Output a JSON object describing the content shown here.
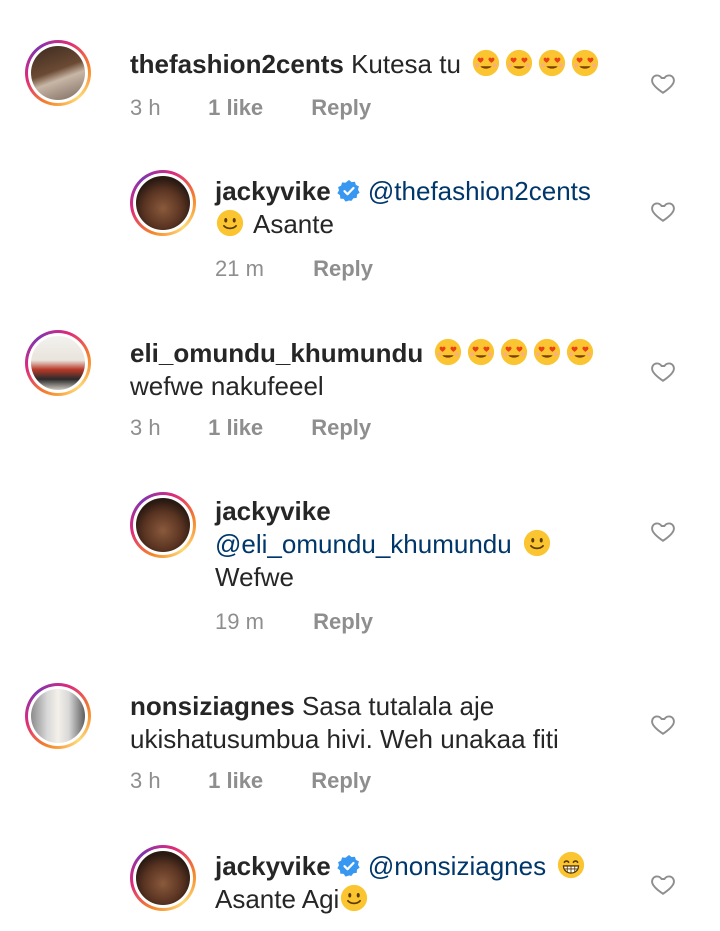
{
  "comments": [
    {
      "username": "thefashion2cents",
      "text": "Kutesa tu",
      "emojis": [
        "heart-eyes",
        "heart-eyes",
        "heart-eyes",
        "heart-eyes"
      ],
      "time": "3 h",
      "likes": "1 like",
      "reply": "Reply",
      "replies": [
        {
          "username": "jackyvike",
          "verified": true,
          "mention": "@thefashion2cents",
          "text": "Asante",
          "time": "21 m",
          "reply": "Reply"
        }
      ]
    },
    {
      "username": "eli_omundu_khumundu",
      "text": "wefwe nakufeeel",
      "emojis": [
        "heart-eyes",
        "heart-eyes",
        "heart-eyes",
        "heart-eyes",
        "heart-eyes"
      ],
      "time": "3 h",
      "likes": "1 like",
      "reply": "Reply",
      "replies": [
        {
          "username": "jackyvike",
          "verified": false,
          "mention": "@eli_omundu_khumundu",
          "text": "Wefwe",
          "time": "19 m",
          "reply": "Reply"
        }
      ]
    },
    {
      "username": "nonsiziagnes",
      "text": "Sasa tutalala aje ukishatusumbua hivi. Weh unakaa fiti",
      "time": "3 h",
      "likes": "1 like",
      "reply": "Reply",
      "replies": [
        {
          "username": "jackyvike",
          "verified": true,
          "mention": "@nonsiziagnes",
          "text": "Asante Agi"
        }
      ]
    }
  ],
  "colors": {
    "mention": "#00376b",
    "meta": "#8e8e8e",
    "verified": "#3897f0"
  }
}
